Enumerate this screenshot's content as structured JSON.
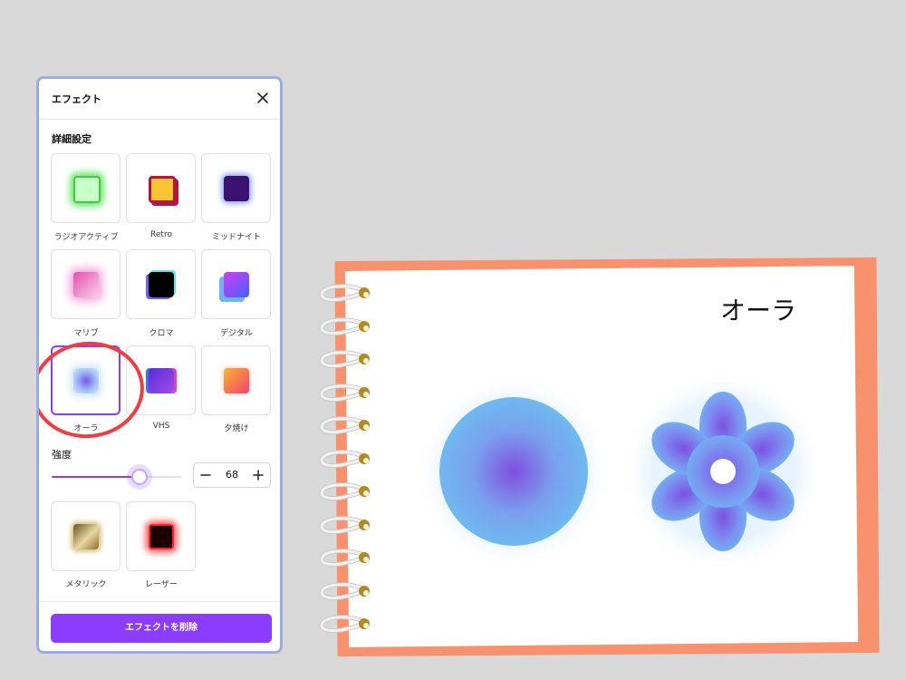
{
  "panel": {
    "title": "エフェクト",
    "section_title": "詳細設定",
    "effects": [
      {
        "label": "ラジオアクティブ",
        "icon": "radioactive-effect-thumbnail"
      },
      {
        "label": "Retro",
        "icon": "retro-effect-thumbnail"
      },
      {
        "label": "ミッドナイト",
        "icon": "midnight-effect-thumbnail"
      },
      {
        "label": "マリブ",
        "icon": "malibu-effect-thumbnail"
      },
      {
        "label": "クロマ",
        "icon": "chroma-effect-thumbnail"
      },
      {
        "label": "デジタル",
        "icon": "digital-effect-thumbnail"
      },
      {
        "label": "オーラ",
        "icon": "aura-effect-thumbnail",
        "selected": true
      },
      {
        "label": "VHS",
        "icon": "vhs-effect-thumbnail"
      },
      {
        "label": "夕焼け",
        "icon": "sunset-effect-thumbnail"
      },
      {
        "label": "メタリック",
        "icon": "metallic-effect-thumbnail"
      },
      {
        "label": "レーザー",
        "icon": "laser-effect-thumbnail"
      }
    ],
    "strength_label": "強度",
    "strength_value": "68",
    "remove_button": "エフェクトを削除"
  },
  "canvas": {
    "title": "オーラ"
  },
  "colors": {
    "accent": "#8b3dff",
    "annotation_circle": "#ef3e42",
    "notebook_back": "#f7916e",
    "background": "#d9d9d9"
  }
}
